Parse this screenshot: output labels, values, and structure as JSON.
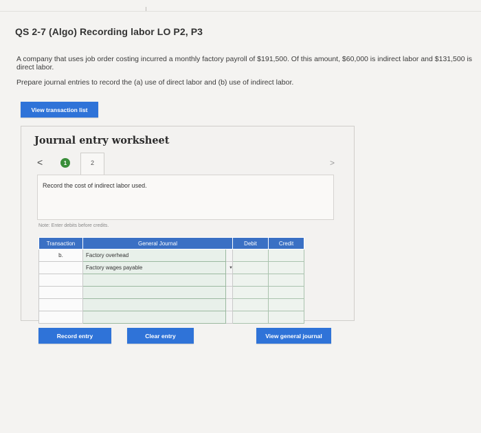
{
  "question": {
    "title": "QS 2-7 (Algo) Recording labor LO P2, P3",
    "text": "A company that uses job order costing incurred a monthly factory payroll of $191,500. Of this amount, $60,000 is indirect labor and $131,500 is direct labor.",
    "instruction": "Prepare journal entries to record the (a) use of direct labor and (b) use of indirect labor."
  },
  "buttons": {
    "view_transaction_list": "View transaction list",
    "record_entry": "Record entry",
    "clear_entry": "Clear entry",
    "view_general_journal": "View general journal"
  },
  "worksheet": {
    "title": "Journal entry worksheet",
    "nav_prev": "<",
    "nav_next": ">",
    "step1": "1",
    "step2": "2",
    "prompt": "Record the cost of indirect labor used.",
    "note": "Note: Enter debits before credits."
  },
  "table": {
    "headers": {
      "transaction": "Transaction",
      "general_journal": "General Journal",
      "debit": "Debit",
      "credit": "Credit"
    },
    "rows": [
      {
        "transaction": "b.",
        "account": "Factory overhead",
        "debit": "",
        "credit": ""
      },
      {
        "transaction": "",
        "account": "Factory wages payable",
        "debit": "",
        "credit": ""
      },
      {
        "transaction": "",
        "account": "",
        "debit": "",
        "credit": ""
      },
      {
        "transaction": "",
        "account": "",
        "debit": "",
        "credit": ""
      },
      {
        "transaction": "",
        "account": "",
        "debit": "",
        "credit": ""
      },
      {
        "transaction": "",
        "account": "",
        "debit": "",
        "credit": ""
      }
    ]
  },
  "colors": {
    "accent": "#2f73d8",
    "header": "#3a70c4",
    "step_done": "#3a8e3a"
  }
}
